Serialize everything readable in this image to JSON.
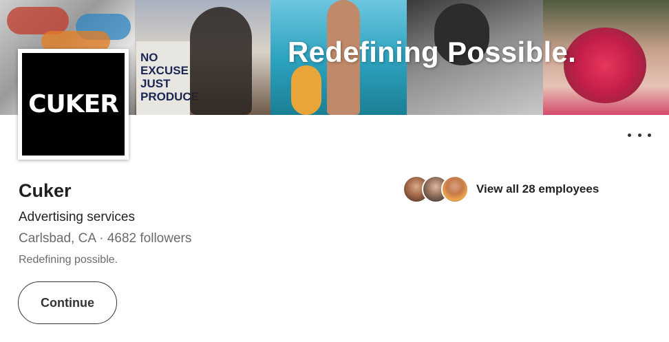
{
  "banner": {
    "title": "Redefining Possible.",
    "sign_text": [
      "NO",
      "EXCUSE",
      "JUST",
      "PRODUCE"
    ]
  },
  "company": {
    "logo_text": "CUKER",
    "name": "Cuker",
    "industry": "Advertising services",
    "location_followers": "Carlsbad, CA · 4682 followers",
    "tagline": "Redefining possible."
  },
  "actions": {
    "continue_label": "Continue",
    "more_icon": "more-horizontal-icon"
  },
  "employees": {
    "label": "View all 28 employees"
  }
}
